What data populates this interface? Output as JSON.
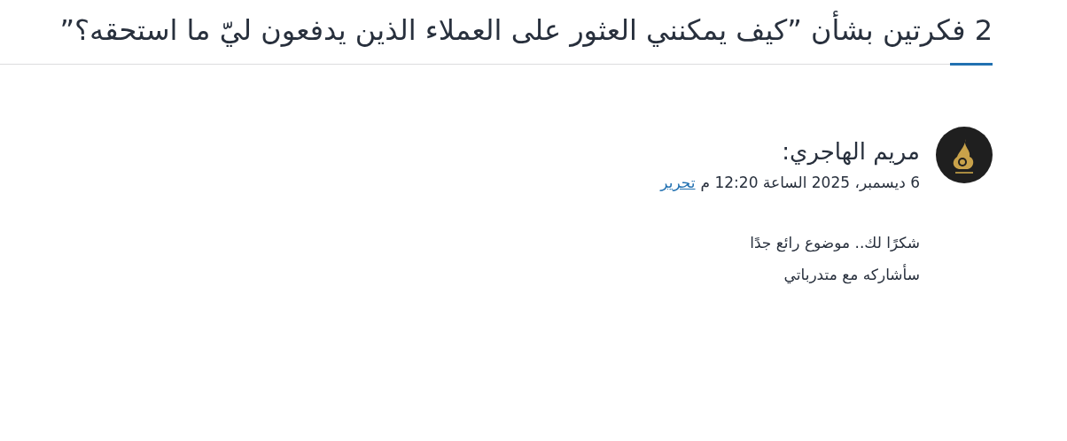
{
  "title": "2 فكرتين بشأن ”كيف يمكنني العثور على العملاء الذين يدفعون ليّ ما استحقه؟”",
  "comments": [
    {
      "author": "مريم الهاجري:",
      "date": "6 ديسمبر، 2025 الساعة 12:20 م",
      "edit_link": "تحرير",
      "paragraphs": [
        "شكرًا لك.. موضوع رائع جدًا",
        "سأشاركه مع متدرباتي"
      ]
    }
  ]
}
